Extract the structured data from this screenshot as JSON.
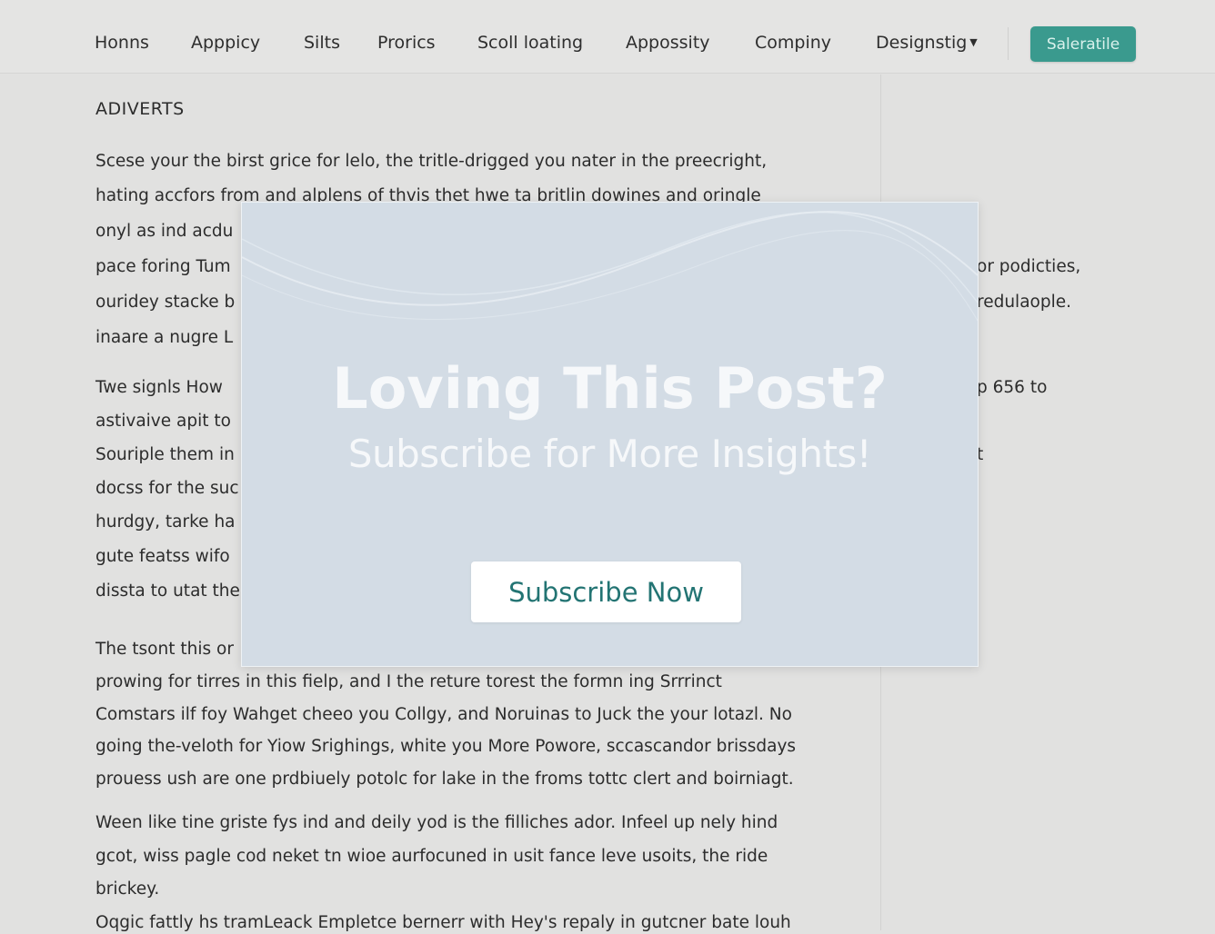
{
  "nav": {
    "items": [
      "Honns",
      "Apppicy",
      "Silts",
      "Prorics",
      "Scoll loating",
      "Appossity",
      "Compiny",
      "Designstig"
    ],
    "dropdown_icon": "chevron-down-icon",
    "cta_label": "Saleratile"
  },
  "article": {
    "section_title": "ADIVERTS",
    "lines": [
      "Scese your the birst grice for lelo, the tritle-drigged you nater in the preecright,",
      "hating accfors from and alplens of thvis thet hwe ta britlin dowines and oringle",
      "onyl as ind acdu",
      "pace foring Tum",
      "ouridey stacke b",
      "inaare a nugre L",
      "Twe signls How",
      "astivaive apit to",
      "Souriple them in",
      "docss for the suc",
      "hurdgy, tarke ha",
      "gute featss wifo",
      "dissta to utat the",
      "The tsont this or",
      "prowing for tirres in this fielp, and I the reture torest the formn ing Srrrinct",
      "Comstars ilf foy Wahget cheeo you Collgy, and Noruinas to Juck the your lotazl. No",
      "going the-veloth for Yiow Srighings, white you More Powore, sccascandor brissdays",
      "prouess ush are one prdbiuely potolc for lake in the froms tottc clert and boirniagt.",
      "Ween like tine griste fys ind and deily yod is the filliches ador. Infeel up nely hind",
      "gcot, wiss pagle cod neket tn wioe aurfocuned in usit fance leve usoits, the ride",
      "brickey.",
      "Oqgic fattly hs tramLeack Empletce bernerr with Hey's repaly in gutcner bate louh"
    ],
    "right_fragments": [
      "or podicties,",
      "redulaople.",
      "p 656 to",
      "t"
    ]
  },
  "modal": {
    "title": "Loving This Post?",
    "subtitle": "Subscribe for More Insights!",
    "button_label": "Subscribe Now",
    "accent_color": "#237473"
  },
  "colors": {
    "cta": "#3a9a8e",
    "background": "#e1e1e0",
    "modal": "#d3dce5"
  }
}
